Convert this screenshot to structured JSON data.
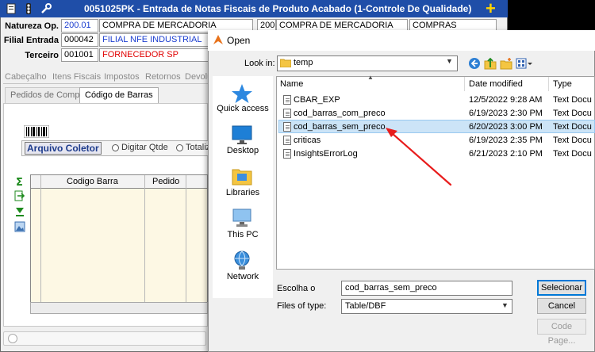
{
  "app": {
    "title": "0051025PK - Entrada de Notas Fiscais de Produto Acabado (1-Controle De Qualidade)",
    "fields": {
      "natureza_label": "Natureza Op.",
      "natureza_code": "200.01",
      "natureza_desc": "COMPRA DE MERCADORIA",
      "natureza_code2": "200",
      "natureza_desc2": "COMPRA DE MERCADORIA",
      "natureza_type": "COMPRAS",
      "filial_label": "Filial Entrada",
      "filial_code": "000042",
      "filial_desc": "FILIAL NFE INDUSTRIAL",
      "terceiro_label": "Terceiro",
      "terceiro_code": "001001",
      "terceiro_desc": "FORNECEDOR SP"
    },
    "tabs": [
      "Cabeçalho",
      "Itens Fiscais",
      "Impostos",
      "Retornos",
      "Devolu"
    ],
    "subtabs": [
      "Pedidos de Compra",
      "Código de Barras"
    ],
    "coletor_button": "Arquivo Coletor",
    "radio_digitar": "Digitar Qtde",
    "radio_total": "Totaliz",
    "grid_headers": [
      "Codigo Barra",
      "Pedido"
    ],
    "colors": {
      "titlebar": "#1f4ea8",
      "blue_text": "#1a3ccf",
      "red_text": "#e00000"
    }
  },
  "dialog": {
    "title": "Open",
    "lookin_label": "Look in:",
    "lookin_value": "temp",
    "places": [
      "Quick access",
      "Desktop",
      "Libraries",
      "This PC",
      "Network"
    ],
    "columns": [
      "Name",
      "Date modified",
      "Type"
    ],
    "files": [
      {
        "name": "CBAR_EXP",
        "date": "12/5/2022 9:28 AM",
        "type": "Text Docu"
      },
      {
        "name": "cod_barras_com_preco",
        "date": "6/19/2023 2:30 PM",
        "type": "Text Docu"
      },
      {
        "name": "cod_barras_sem_preco",
        "date": "6/20/2023 3:00 PM",
        "type": "Text Docu"
      },
      {
        "name": "criticas",
        "date": "6/19/2023 2:35 PM",
        "type": "Text Docu"
      },
      {
        "name": "InsightsErrorLog",
        "date": "6/21/2023 2:10 PM",
        "type": "Text Docu"
      }
    ],
    "selected_index": 2,
    "name_label": "Escolha o",
    "name_value": "cod_barras_sem_preco",
    "type_label": "Files of type:",
    "type_value": "Table/DBF",
    "btn_open": "Selecionar",
    "btn_cancel": "Cancel",
    "btn_codepage": "Code Page...",
    "colors": {
      "selection": "#cce4f7",
      "accent": "#0078d7",
      "annotation_arrow": "#e81c1c"
    }
  }
}
